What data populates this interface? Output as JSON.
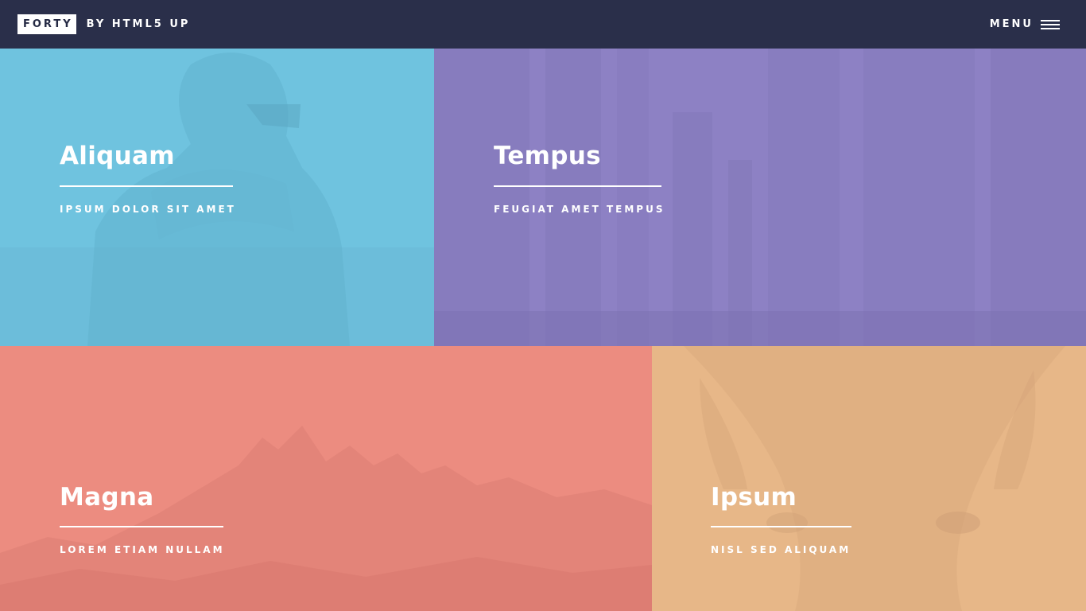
{
  "header": {
    "logo_box": "FORTY",
    "logo_rest": "BY HTML5 UP",
    "menu_label": "MENU"
  },
  "tiles": [
    {
      "title": "Aliquam",
      "subtitle": "IPSUM DOLOR SIT AMET",
      "color": "#6fc3df"
    },
    {
      "title": "Tempus",
      "subtitle": "FEUGIAT AMET TEMPUS",
      "color": "#8d82c4"
    },
    {
      "title": "Magna",
      "subtitle": "LOREM ETIAM NULLAM",
      "color": "#ec8d81"
    },
    {
      "title": "Ipsum",
      "subtitle": "NISL SED ALIQUAM",
      "color": "#e7b788"
    }
  ]
}
